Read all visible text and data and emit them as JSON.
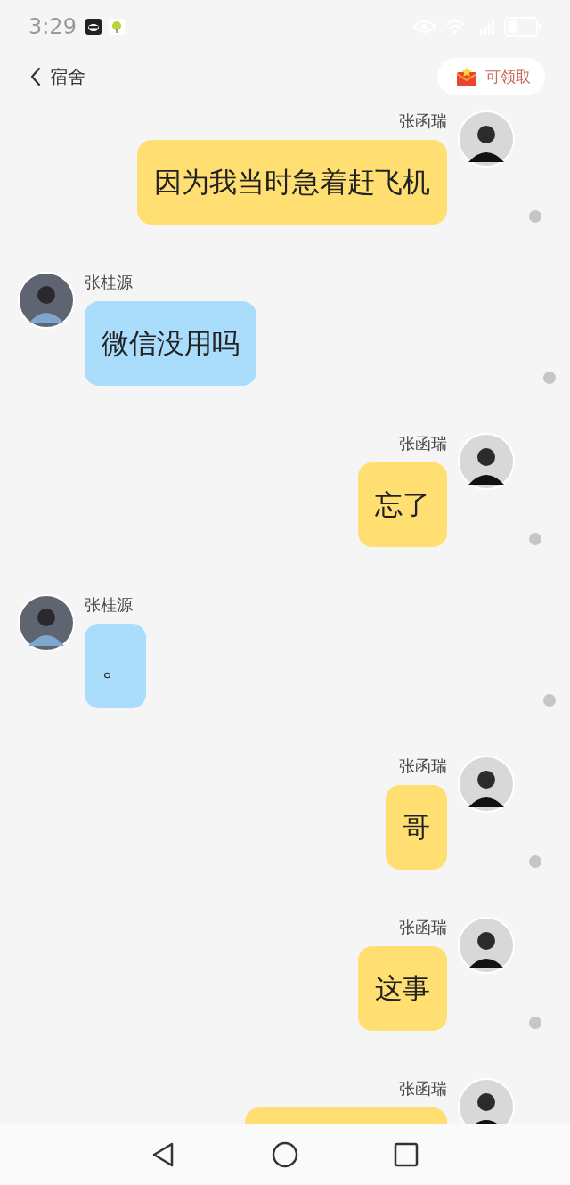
{
  "status_bar": {
    "time": "3:29"
  },
  "header": {
    "back_label": "宿舍",
    "reward_button": "可领取"
  },
  "messages": [
    {
      "kind": "outgoing",
      "sender": "张函瑞",
      "text": "因为我当时急着赶飞机"
    },
    {
      "kind": "incoming",
      "sender": "张桂源",
      "text": "微信没用吗"
    },
    {
      "kind": "outgoing",
      "sender": "张函瑞",
      "text": "忘了"
    },
    {
      "kind": "incoming",
      "sender": "张桂源",
      "text": "。"
    },
    {
      "kind": "outgoing",
      "sender": "张函瑞",
      "text": "哥"
    },
    {
      "kind": "outgoing",
      "sender": "张函瑞",
      "text": "这事"
    },
    {
      "kind": "outgoing",
      "sender": "张函瑞"
    }
  ]
}
